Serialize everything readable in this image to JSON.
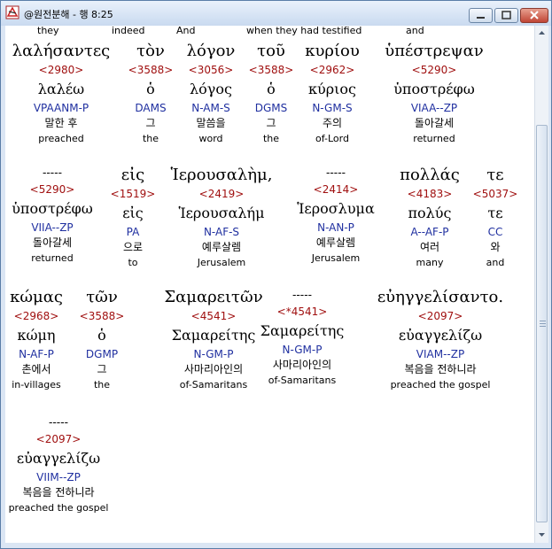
{
  "window": {
    "title": "@원전분해 - 행 8:25"
  },
  "top_row": [
    "they",
    "indeed",
    "And",
    "when they had testified",
    "and"
  ],
  "words": [
    {
      "greek": "λαλήσαντες",
      "strongs": "<2980>",
      "lemma": "λαλέω",
      "parse": "VPAANM-P",
      "korean": "말한 후",
      "english": "preached"
    },
    {
      "greek": "τὸν",
      "strongs": "<3588>",
      "lemma": "ὁ",
      "parse": "DAMS",
      "korean": "그",
      "english": "the"
    },
    {
      "greek": "λόγον",
      "strongs": "<3056>",
      "lemma": "λόγος",
      "parse": "N-AM-S",
      "korean": "말씀을",
      "english": "word"
    },
    {
      "greek": "τοῦ",
      "strongs": "<3588>",
      "lemma": "ὁ",
      "parse": "DGMS",
      "korean": "그",
      "english": "the"
    },
    {
      "greek": "κυρίου",
      "strongs": "<2962>",
      "lemma": "κύριος",
      "parse": "N-GM-S",
      "korean": "주의",
      "english": "of-Lord"
    },
    {
      "greek": "ὑπέστρεψαν",
      "strongs": "<5290>",
      "lemma": "ὑποστρέφω",
      "parse": "VIAA--ZP",
      "korean": "돌아갈세",
      "english": "returned"
    },
    {
      "greek": "-----",
      "strongs": "<5290>",
      "lemma": "ὑποστρέφω",
      "parse": "VIIA--ZP",
      "korean": "돌아갈세",
      "english": "returned"
    },
    {
      "greek": "εἰς",
      "strongs": "<1519>",
      "lemma": "εἰς",
      "parse": "PA",
      "korean": "으로",
      "english": "to"
    },
    {
      "greek": "Ἱερουσαλὴμ,",
      "strongs": "<2419>",
      "lemma": "Ἱερουσαλήμ",
      "parse": "N-AF-S",
      "korean": "예루살렘",
      "english": "Jerusalem"
    },
    {
      "greek": "-----",
      "strongs": "<2414>",
      "lemma": "Ἱεροσλυμα",
      "parse": "N-AN-P",
      "korean": "예루살렘",
      "english": "Jerusalem"
    },
    {
      "greek": "πολλάς",
      "strongs": "<4183>",
      "lemma": "πολύς",
      "parse": "A--AF-P",
      "korean": "여러",
      "english": "many"
    },
    {
      "greek": "τε",
      "strongs": "<5037>",
      "lemma": "τε",
      "parse": "CC",
      "korean": "와",
      "english": "and"
    },
    {
      "greek": "κώμας",
      "strongs": "<2968>",
      "lemma": "κώμη",
      "parse": "N-AF-P",
      "korean": "촌에서",
      "english": "in-villages"
    },
    {
      "greek": "τῶν",
      "strongs": "<3588>",
      "lemma": "ὁ",
      "parse": "DGMP",
      "korean": "그",
      "english": "the"
    },
    {
      "greek": "Σαμαρειτῶν",
      "strongs": "<4541>",
      "lemma": "Σαμαρείτης",
      "parse": "N-GM-P",
      "korean": "사마리아인의",
      "english": "of-Samaritans"
    },
    {
      "greek": "-----",
      "strongs": "<*4541>",
      "lemma": "Σαμαρείτης",
      "parse": "N-GM-P",
      "korean": "사마리아인의",
      "english": "of-Samaritans"
    },
    {
      "greek": "εὐηγγελίσαντο.",
      "strongs": "<2097>",
      "lemma": "εὐαγγελίζω",
      "parse": "VIAM--ZP",
      "korean": "복음을 전하니라",
      "english": "preached the gospel"
    },
    {
      "greek": "-----",
      "strongs": "<2097>",
      "lemma": "εὐαγγελίζω",
      "parse": "VIIM--ZP",
      "korean": "복음을 전하니라",
      "english": "preached the gospel"
    }
  ]
}
